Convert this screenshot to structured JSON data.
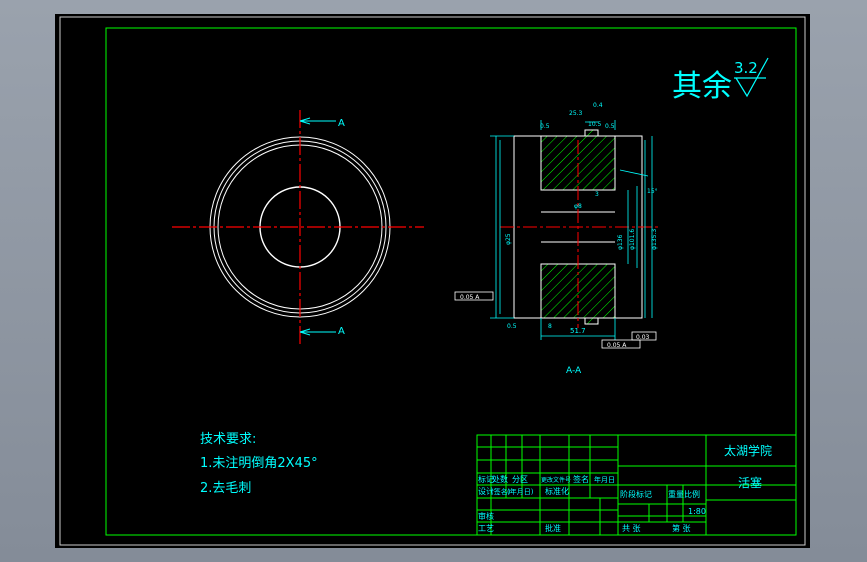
{
  "roughness": {
    "prefix": "其余",
    "value": "3.2"
  },
  "section": {
    "cut_mark": "A",
    "label": "A-A"
  },
  "dims": {
    "d_top1": "0.4",
    "d_top2": "25.3",
    "d_top3": "10.5",
    "chamfer_l": "0.5",
    "chamfer_r": "0.5",
    "inner_3": "3",
    "bore_label": "φ8",
    "angle": "15°",
    "dia1": "φ136",
    "dia2": "φ101.6",
    "dia3": "φ135.3",
    "height": "φ25",
    "flat_label": "8",
    "bottom_dim": "51.7",
    "bottom_small": "0.5",
    "tol_left": "0.05 A",
    "tol_bottom": "0.05 A",
    "tol_right": "0.03"
  },
  "notes": {
    "heading": "技术要求:",
    "items": [
      "1.未注明倒角2X45°",
      "2.去毛刺"
    ]
  },
  "title_block": {
    "school": "太湖学院",
    "part_name": "活塞",
    "row_headers": [
      "标记",
      "处数",
      "分区",
      "更改文件号",
      "签名",
      "年月日"
    ],
    "row2": [
      "设计",
      "(签名)",
      "(年月日)",
      "标准化"
    ],
    "stage_labels": [
      "阶段标记",
      "重量",
      "比例"
    ],
    "scale": "1:80",
    "approve": "审核",
    "process": "工艺",
    "approved_by": "批准",
    "sheets_total": "共  张",
    "sheet_no": "第  张"
  }
}
